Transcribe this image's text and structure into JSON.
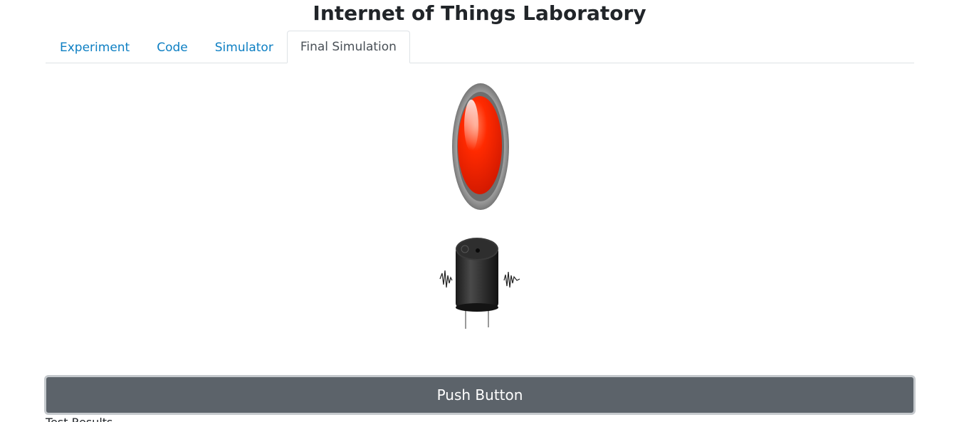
{
  "header": {
    "title": "Internet of Things Laboratory"
  },
  "tabs": [
    {
      "label": "Experiment",
      "active": false
    },
    {
      "label": "Code",
      "active": false
    },
    {
      "label": "Simulator",
      "active": false
    },
    {
      "label": "Final Simulation",
      "active": true
    }
  ],
  "simulation": {
    "button_icon": "red-push-button-icon",
    "buzzer_icon": "buzzer-icon",
    "button_color": "#ff2200",
    "buzzer_color": "#2b2b2b"
  },
  "controls": {
    "push_button_label": "Push Button"
  },
  "result": {
    "label": "Test Results"
  },
  "colors": {
    "tab_link": "#0d7fc3",
    "button_bg": "#5c636a"
  }
}
